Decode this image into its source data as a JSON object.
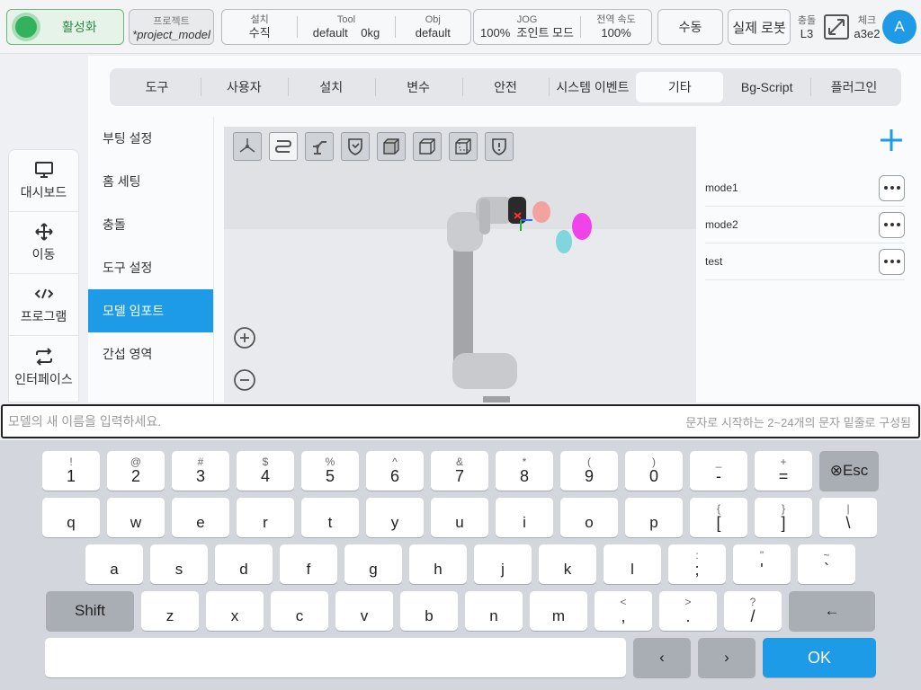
{
  "topbar": {
    "activate_label": "활성화",
    "project_title": "프로젝트",
    "project_value": "*project_model",
    "install": [
      {
        "title": "설치",
        "value": "수직"
      },
      {
        "title": "Tool",
        "value": "default    0kg"
      },
      {
        "title": "Obj",
        "value": "default"
      }
    ],
    "jog": [
      {
        "title": "JOG",
        "value": "100%  조인트 모드"
      },
      {
        "title": "전역 속도",
        "value": "100%"
      }
    ],
    "manual_label": "수동",
    "realrobot_label": "실제 로봇",
    "collision_title": "충돌",
    "collision_value": "L3",
    "check_title": "체크",
    "check_value": "a3e2",
    "avatar_letter": "A"
  },
  "nav": [
    {
      "icon": "monitor-icon",
      "label": "대시보드"
    },
    {
      "icon": "move-icon",
      "label": "이동"
    },
    {
      "icon": "code-icon",
      "label": "프로그램"
    },
    {
      "icon": "interface-icon",
      "label": "인터페이스"
    }
  ],
  "tabs": [
    "도구",
    "사용자",
    "설치",
    "변수",
    "안전",
    "시스템 이벤트",
    "기타",
    "Bg-Script",
    "플러그인"
  ],
  "active_tab": "기타",
  "submenu": [
    "부팅 설정",
    "홈 세팅",
    "충돌",
    "도구 설정",
    "모델 임포트",
    "간섭 영역"
  ],
  "active_submenu": "모델 임포트",
  "models": [
    "mode1",
    "mode2",
    "test"
  ],
  "input": {
    "placeholder": "모델의 새 이름을 입력하세요.",
    "hint": "문자로 시작하는 2~24개의 문자 밑줄로 구성됨"
  },
  "keyboard": {
    "row1": [
      {
        "s": "!",
        "m": "1"
      },
      {
        "s": "@",
        "m": "2"
      },
      {
        "s": "#",
        "m": "3"
      },
      {
        "s": "$",
        "m": "4"
      },
      {
        "s": "%",
        "m": "5"
      },
      {
        "s": "^",
        "m": "6"
      },
      {
        "s": "&",
        "m": "7"
      },
      {
        "s": "*",
        "m": "8"
      },
      {
        "s": "(",
        "m": "9"
      },
      {
        "s": ")",
        "m": "0"
      },
      {
        "s": "_",
        "m": "-"
      },
      {
        "s": "+",
        "m": "="
      }
    ],
    "esc_label": "⊗Esc",
    "row2": [
      {
        "s": "",
        "m": "q"
      },
      {
        "s": "",
        "m": "w"
      },
      {
        "s": "",
        "m": "e"
      },
      {
        "s": "",
        "m": "r"
      },
      {
        "s": "",
        "m": "t"
      },
      {
        "s": "",
        "m": "y"
      },
      {
        "s": "",
        "m": "u"
      },
      {
        "s": "",
        "m": "i"
      },
      {
        "s": "",
        "m": "o"
      },
      {
        "s": "",
        "m": "p"
      },
      {
        "s": "{",
        "m": "["
      },
      {
        "s": "}",
        "m": "]"
      },
      {
        "s": "|",
        "m": "\\"
      }
    ],
    "row3": [
      {
        "s": "",
        "m": "a"
      },
      {
        "s": "",
        "m": "s"
      },
      {
        "s": "",
        "m": "d"
      },
      {
        "s": "",
        "m": "f"
      },
      {
        "s": "",
        "m": "g"
      },
      {
        "s": "",
        "m": "h"
      },
      {
        "s": "",
        "m": "j"
      },
      {
        "s": "",
        "m": "k"
      },
      {
        "s": "",
        "m": "l"
      },
      {
        "s": ":",
        "m": ";"
      },
      {
        "s": "\"",
        "m": "'"
      },
      {
        "s": "~",
        "m": "`"
      }
    ],
    "shift_label": "Shift",
    "row4": [
      {
        "s": "",
        "m": "z"
      },
      {
        "s": "",
        "m": "x"
      },
      {
        "s": "",
        "m": "c"
      },
      {
        "s": "",
        "m": "v"
      },
      {
        "s": "",
        "m": "b"
      },
      {
        "s": "",
        "m": "n"
      },
      {
        "s": "",
        "m": "m"
      },
      {
        "s": "<",
        "m": ","
      },
      {
        "s": ">",
        "m": "."
      },
      {
        "s": "?",
        "m": "/"
      }
    ],
    "backspace_label": "←",
    "left_label": "‹",
    "right_label": "›",
    "ok_label": "OK"
  },
  "colors": {
    "accent": "#1e9be6",
    "active_green": "#33b25e",
    "keyboard_bg": "#d3d6dc"
  }
}
